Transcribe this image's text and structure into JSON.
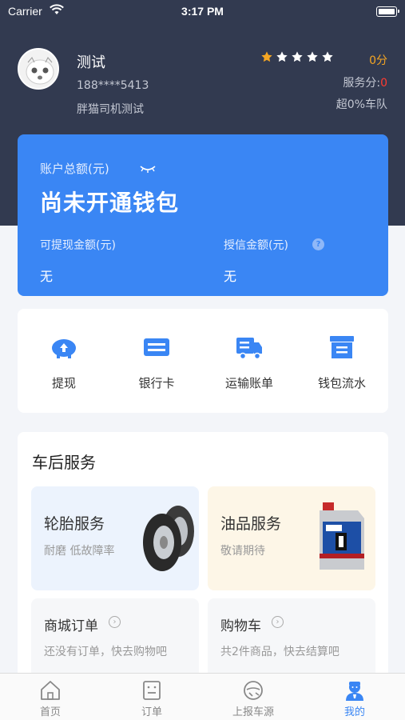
{
  "status_bar": {
    "carrier": "Carrier",
    "time": "3:17 PM"
  },
  "profile": {
    "name": "测试",
    "phone": "188****5413",
    "team": "胖猫司机测试",
    "rating_stars": 5,
    "rating_filled": 1,
    "score": "0分",
    "service_label": "服务分:",
    "service_value": "0",
    "rank": "超0%车队"
  },
  "wallet": {
    "total_label": "账户总额(元)",
    "status": "尚未开通钱包",
    "withdrawable_label": "可提现金额(元)",
    "withdrawable_value": "无",
    "credit_label": "授信金额(元)",
    "credit_value": "无",
    "help_icon_text": "?"
  },
  "actions": [
    {
      "label": "提现",
      "icon": "piggy-bank-icon"
    },
    {
      "label": "银行卡",
      "icon": "bank-card-icon"
    },
    {
      "label": "运输账单",
      "icon": "truck-bill-icon"
    },
    {
      "label": "钱包流水",
      "icon": "wallet-flow-icon"
    }
  ],
  "services": {
    "title": "车后服务",
    "tire": {
      "title": "轮胎服务",
      "subtitle": "耐磨 低故障率"
    },
    "oil": {
      "title": "油品服务",
      "subtitle": "敬请期待"
    },
    "orders": {
      "title": "商城订单",
      "subtitle": "还没有订单，快去购物吧"
    },
    "cart": {
      "title": "购物车",
      "subtitle": "共2件商品，快去结算吧"
    }
  },
  "tabs": [
    {
      "label": "首页",
      "icon": "home-icon"
    },
    {
      "label": "订单",
      "icon": "orders-icon"
    },
    {
      "label": "上报车源",
      "icon": "report-vehicle-icon"
    },
    {
      "label": "我的",
      "icon": "profile-icon",
      "active": true
    }
  ],
  "colors": {
    "header_bg": "#323a50",
    "accent": "#3a86f4",
    "star": "#f5a623",
    "alert": "#ff3b30"
  }
}
